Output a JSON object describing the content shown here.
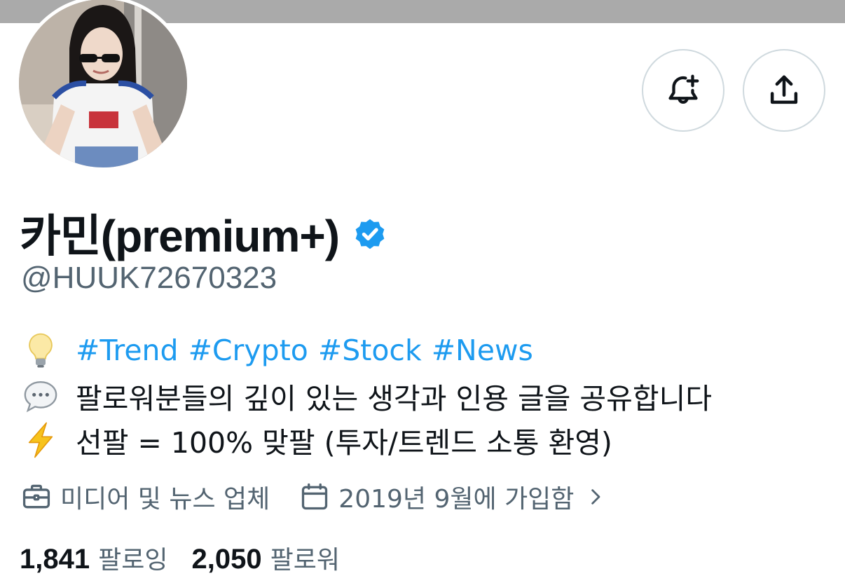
{
  "profile": {
    "display_name": "카민(premium+)",
    "handle": "@HUUK72670323",
    "verified": true,
    "verified_color": "#1d9bf0",
    "avatar": "profile-photo"
  },
  "actions": {
    "notify_icon": "bell-plus-icon",
    "share_icon": "share-upload-icon"
  },
  "bio": {
    "line1": {
      "emoji": "light-bulb-emoji",
      "hashtags": [
        "#Trend",
        "#Crypto",
        "#Stock",
        "#News"
      ]
    },
    "line2": {
      "emoji": "speech-bubble-emoji",
      "text": "팔로워분들의 깊이 있는 생각과 인용 글을 공유합니다"
    },
    "line3": {
      "emoji": "lightning-emoji",
      "text": "선팔 = 100% 맞팔 (투자/트렌드 소통 환영)"
    }
  },
  "meta": {
    "category_icon": "briefcase-icon",
    "category": "미디어 및 뉴스 업체",
    "joined_icon": "calendar-icon",
    "joined": "2019년 9월에 가입함"
  },
  "stats": {
    "following_count": "1,841",
    "following_label": "팔로잉",
    "followers_count": "2,050",
    "followers_label": "팔로워"
  },
  "colors": {
    "accent": "#1d9bf0",
    "secondary_text": "#536471",
    "primary_text": "#0f1419",
    "border": "#cfd9de",
    "banner": "#aaaaaa"
  }
}
